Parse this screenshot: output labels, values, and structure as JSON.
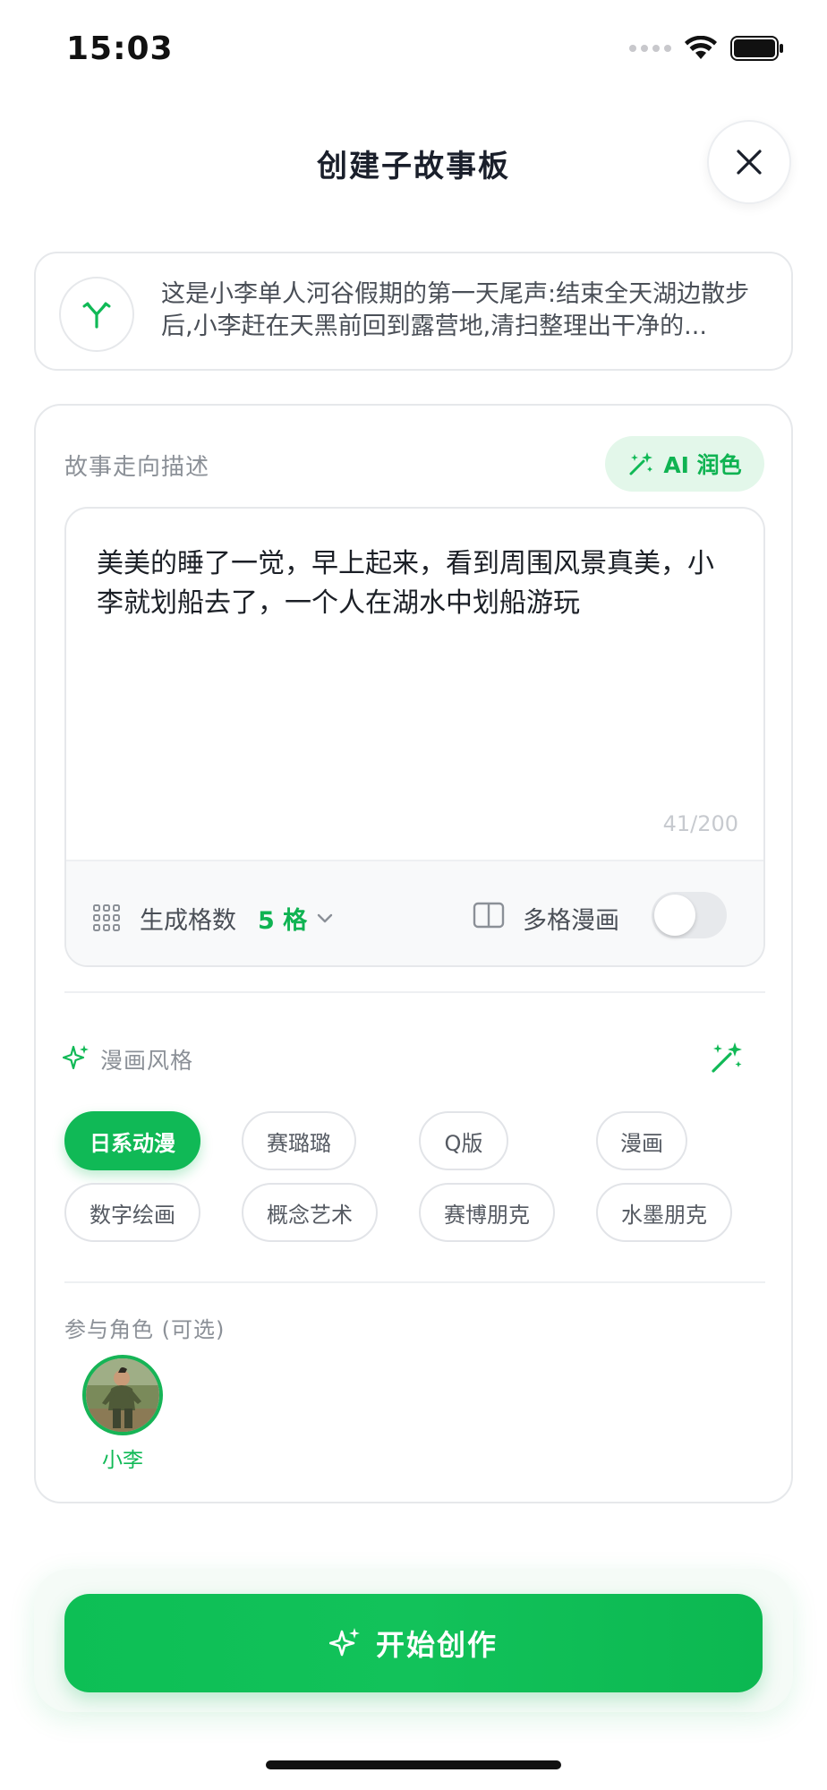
{
  "status_bar": {
    "time": "15:03"
  },
  "header": {
    "title": "创建子故事板"
  },
  "summary": {
    "text": "这是小李单人河谷假期的第一天尾声:结束全天湖边散步后,小李赶在天黑前回到露营地,清扫整理出干净的..."
  },
  "story": {
    "label": "故事走向描述",
    "ai_polish_label": "AI 润色",
    "content": "美美的睡了一觉，早上起来，看到周围风景真美，小李就划船去了，一个人在湖水中划船游玩",
    "char_count": "41/200",
    "grid_label": "生成格数",
    "grid_value": "5 格",
    "multi_panel_label": "多格漫画",
    "multi_panel_enabled": false
  },
  "style": {
    "label": "漫画风格",
    "chips": [
      "日系动漫",
      "赛璐璐",
      "Q版",
      "漫画",
      "数字绘画",
      "概念艺术",
      "赛博朋克",
      "水墨朋克"
    ],
    "selected": "日系动漫"
  },
  "characters": {
    "label": "参与角色 (可选)",
    "items": [
      {
        "name": "小李"
      }
    ]
  },
  "cta": {
    "label": "开始创作"
  },
  "colors": {
    "accent": "#10b956",
    "accent_light": "#e3f7ea"
  }
}
